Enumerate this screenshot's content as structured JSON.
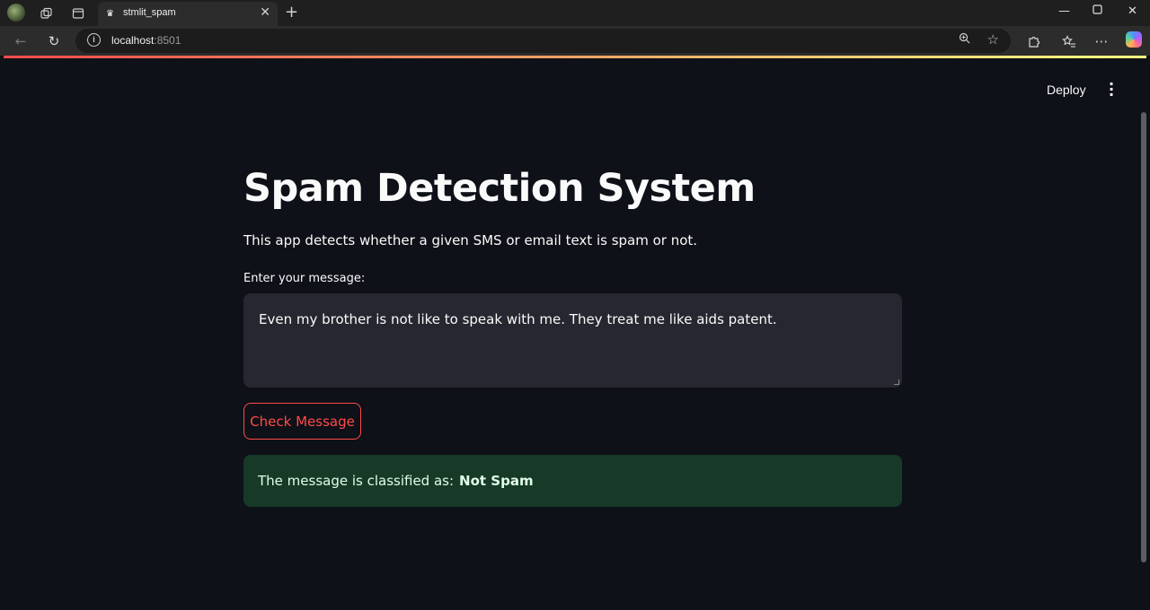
{
  "browser": {
    "tab_title": "stmlit_spam",
    "url_host": "localhost",
    "url_port": ":8501",
    "icons": {
      "profile": "profile-avatar-icon",
      "workspaces": "workspaces-icon",
      "tab_actions": "tab-actions-icon",
      "favicon": "streamlit-crown-icon",
      "close": "close-icon",
      "new_tab": "plus-icon",
      "back": "back-arrow-icon",
      "reload": "reload-icon",
      "info": "info-icon",
      "zoom": "zoom-icon",
      "favorite": "star-icon",
      "extensions": "puzzle-icon",
      "favorites": "favorites-icon",
      "more": "more-dots-icon",
      "copilot": "copilot-icon",
      "minimize": "minimize-icon",
      "maximize": "maximize-icon",
      "window_close": "window-close-icon"
    }
  },
  "app": {
    "deploy_label": "Deploy",
    "title": "Spam Detection System",
    "description": "This app detects whether a given SMS or email text is spam or not.",
    "input_label": "Enter your message:",
    "input_value": "Even my brother is not like to speak with me. They treat me like aids patent.",
    "button_label": "Check Message",
    "result_prefix": "The message is classified as:",
    "result_verdict": "Not Spam",
    "colors": {
      "background": "#0e1117",
      "accent": "#ff4b4b",
      "success_bg": "#173928",
      "success_text": "#dffde9",
      "input_bg": "#262730"
    }
  }
}
